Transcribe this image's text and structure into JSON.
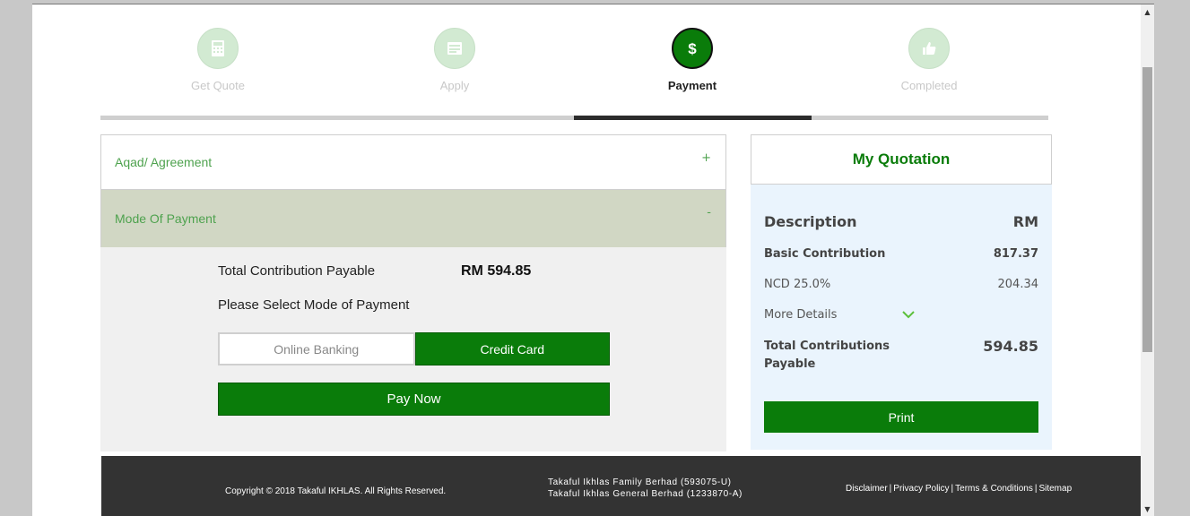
{
  "steps": [
    {
      "label": "Get Quote",
      "icon": "calculator-icon",
      "state": "done"
    },
    {
      "label": "Apply",
      "icon": "form-icon",
      "state": "done"
    },
    {
      "label": "Payment",
      "icon": "dollar-icon",
      "state": "active"
    },
    {
      "label": "Completed",
      "icon": "thumbs-up-icon",
      "state": "pending"
    }
  ],
  "progress_step": 3,
  "accordion": {
    "agreement": {
      "title": "Aqad/ Agreement",
      "toggle": "+"
    },
    "payment": {
      "title": "Mode Of Payment",
      "toggle": "-"
    }
  },
  "payment": {
    "total_label": "Total Contribution Payable",
    "total_value": "RM 594.85",
    "select_label": "Please Select Mode of Payment",
    "online_banking": "Online Banking",
    "credit_card": "Credit Card",
    "selected": "Credit Card",
    "pay_now": "Pay Now"
  },
  "quotation": {
    "title": "My Quotation",
    "desc_label": "Description",
    "desc_unit": "RM",
    "basic_label": "Basic Contribution",
    "basic_value": "817.37",
    "ncd_label": "NCD 25.0%",
    "ncd_value": "204.34",
    "more_details": "More Details",
    "total_label": "Total Contributions Payable",
    "total_value": "594.85",
    "print": "Print"
  },
  "footer": {
    "copyright": "Copyright © 2018 Takaful IKHLAS. All Rights Reserved.",
    "company_1": "Takaful Ikhlas Family Berhad (593075-U)",
    "company_2": "Takaful Ikhlas General Berhad (1233870-A)",
    "links": [
      "Disclaimer",
      "Privacy Policy",
      "Terms & Conditions",
      "Sitemap"
    ]
  },
  "colors": {
    "brand_green": "#0a7c0a",
    "accent_green": "#4ea24e",
    "light_green": "#d2ead2",
    "footer_bg": "#333333"
  }
}
